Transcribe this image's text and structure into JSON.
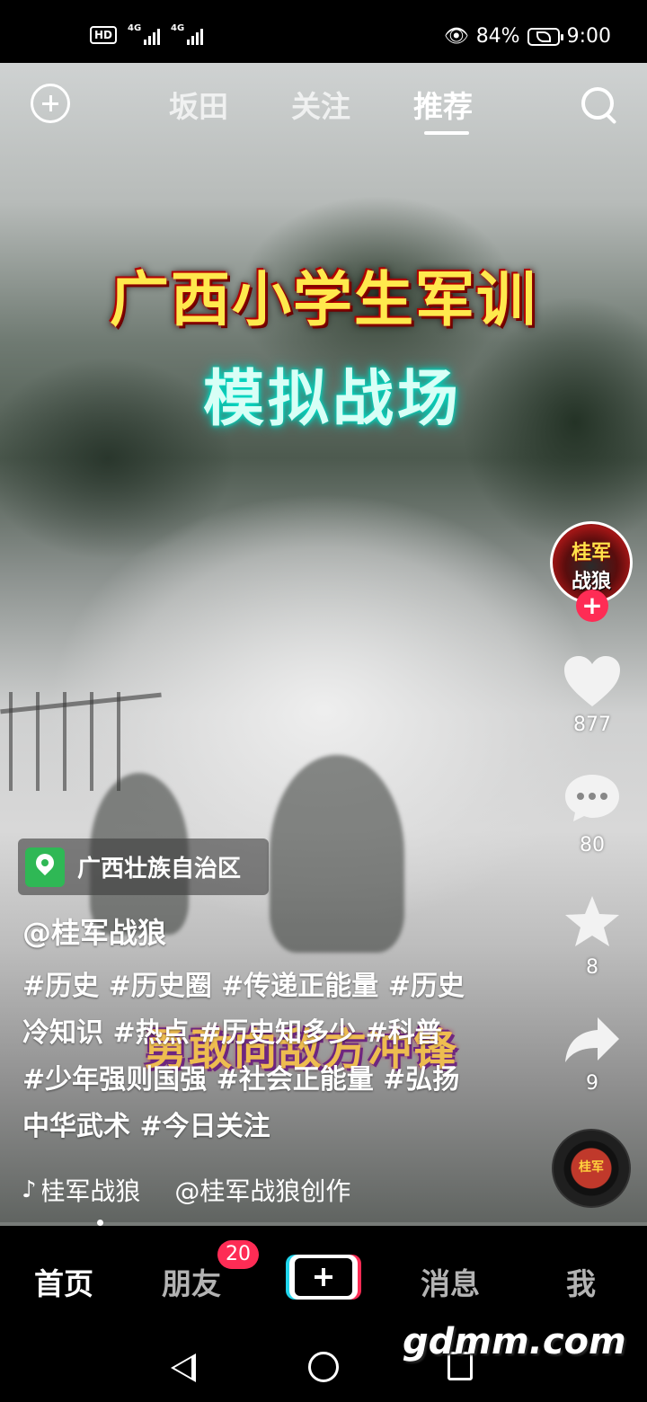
{
  "status_bar": {
    "left_badges": [
      "HD",
      "4G",
      "4G"
    ],
    "battery_percent": "84%",
    "time": "9:00",
    "icons": [
      "eye-icon",
      "battery-icon",
      "leaf-icon"
    ]
  },
  "top_tabs": {
    "items": [
      {
        "label": "坂田",
        "active": false
      },
      {
        "label": "关注",
        "active": false
      },
      {
        "label": "推荐",
        "active": true
      }
    ],
    "left_icon": "add-circle-icon",
    "right_icon": "search-icon"
  },
  "video": {
    "title_line1": "广西小学生军训",
    "title_line2": "模拟战场",
    "subtitle": "勇敢向敌方冲锋"
  },
  "creator": {
    "avatar_line1": "桂军",
    "avatar_line2": "战狼",
    "follow_icon": "plus-icon"
  },
  "actions": {
    "likes": "877",
    "comments": "80",
    "favorites": "8",
    "shares": "9"
  },
  "post": {
    "location": "广西壮族自治区",
    "author": "@桂军战狼",
    "description": "#历史 #历史圈 #传递正能量 #历史冷知识 #热点 #历史知多少 #科普 #少年强则国强 #社会正能量 #弘扬中华武术 #今日关注"
  },
  "music": {
    "track_fragment": "桂军战狼",
    "original_sound": "@桂军战狼创作",
    "disc_label": "桂军"
  },
  "bottom_nav": {
    "items": [
      {
        "label": "首页",
        "active": true
      },
      {
        "label": "朋友",
        "active": false
      },
      {
        "label": "消息",
        "active": false
      },
      {
        "label": "我",
        "active": false
      }
    ],
    "friends_badge": "20",
    "create_icon": "plus-icon"
  },
  "watermark": "gdmm.com",
  "colors": {
    "accent_red": "#fe2c55",
    "accent_cyan": "#20d5ec",
    "location_green": "#2fb855"
  }
}
